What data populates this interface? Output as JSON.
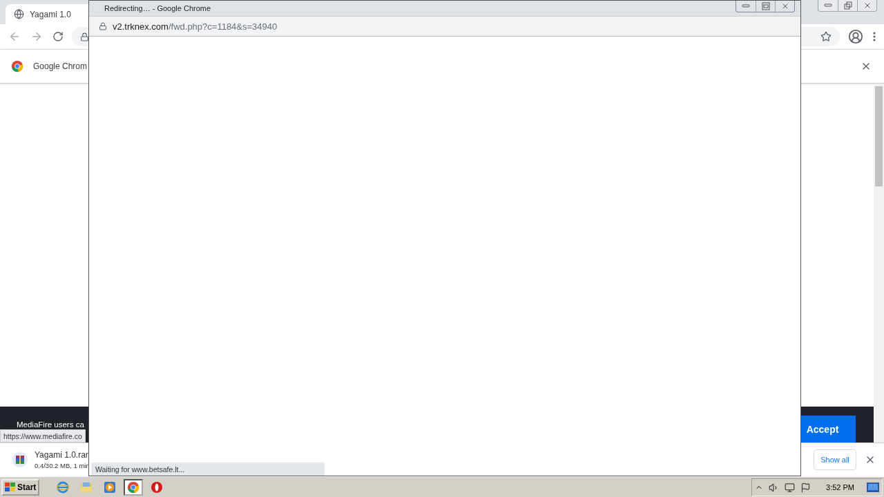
{
  "browser": {
    "tab": {
      "title": "Yagami 1.0",
      "selected": true
    },
    "infobar": {
      "text": "Google Chrom"
    },
    "page": {
      "banner_text": "MediaFire users ca",
      "accept_button": "Accept"
    },
    "status_bubble": "https://www.mediafire.co",
    "download_shelf": {
      "file_name": "Yagami 1.0.rar",
      "progress": "0.4/30.2 MB, 1 min",
      "show_all": "Show all"
    }
  },
  "popup": {
    "title": "Redirecting… - Google Chrome",
    "url_host": "v2.trknex.com",
    "url_path": "/fwd.php?c=1184&s=34940",
    "status": "Waiting for www.betsafe.lt..."
  },
  "taskbar": {
    "start": "Start",
    "apps": [
      {
        "kind": "ie",
        "active": false
      },
      {
        "kind": "folder",
        "active": false
      },
      {
        "kind": "media",
        "active": false
      },
      {
        "kind": "chrome",
        "active": true
      },
      {
        "kind": "opera",
        "active": false
      }
    ],
    "clock": "3:52 PM"
  }
}
